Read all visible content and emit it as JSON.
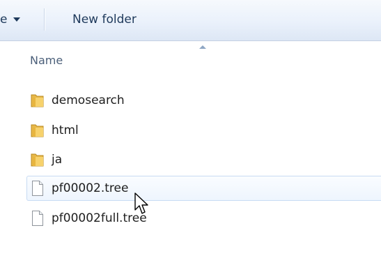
{
  "toolbar": {
    "organize_label": "e",
    "new_folder_label": "New folder"
  },
  "header": {
    "name_column": "Name"
  },
  "files": [
    {
      "name": "demosearch",
      "type": "folder",
      "icon": "folder-icon"
    },
    {
      "name": "html",
      "type": "folder",
      "icon": "folder-icon"
    },
    {
      "name": "ja",
      "type": "folder",
      "icon": "folder-icon"
    },
    {
      "name": "pf00002.tree",
      "type": "file",
      "icon": "document-icon"
    },
    {
      "name": "pf00002full.tree",
      "type": "file",
      "icon": "document-icon"
    }
  ],
  "colors": {
    "toolbar_text": "#1e395b",
    "header_text": "#4c607a",
    "hover_border": "#c7dbf3",
    "folder_yellow": "#f3c04a"
  }
}
